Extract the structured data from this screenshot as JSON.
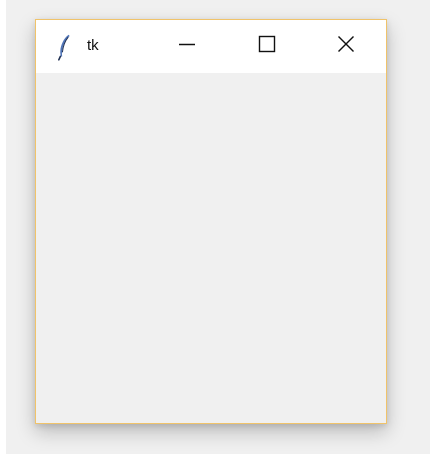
{
  "window": {
    "title": "tk",
    "icons": {
      "app": "feather-icon",
      "minimize": "minimize-icon",
      "maximize": "maximize-icon",
      "close": "close-icon"
    },
    "colors": {
      "border": "#f0c36a",
      "titlebar": "#ffffff",
      "client": "#f0f0f0",
      "icon_blue": "#4f74b8"
    }
  }
}
